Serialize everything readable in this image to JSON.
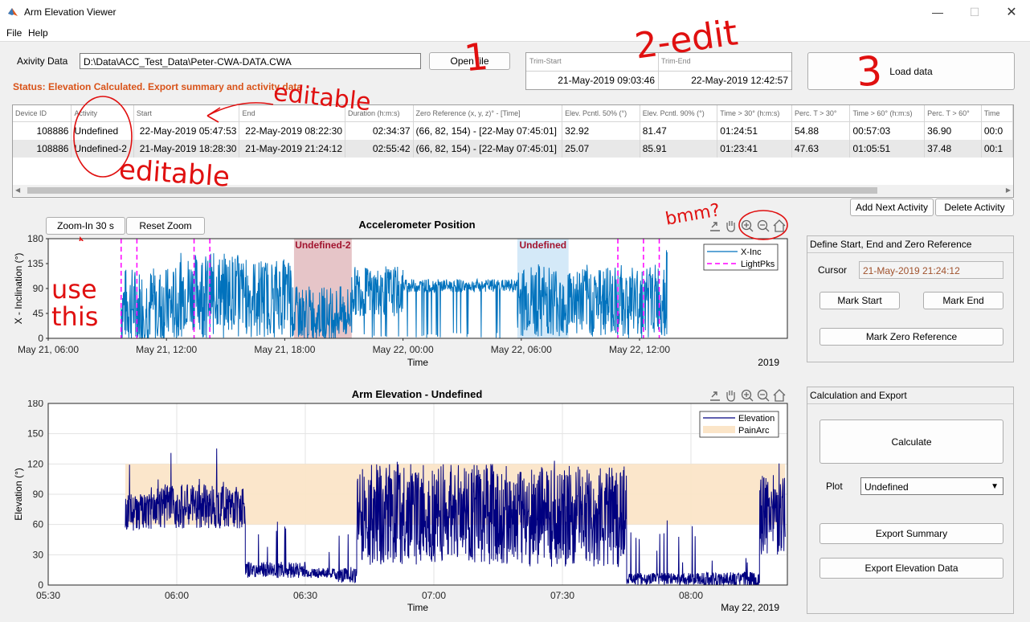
{
  "window": {
    "title": "Arm Elevation Viewer"
  },
  "menu": [
    "File",
    "Help"
  ],
  "data_row": {
    "label": "Axivity Data",
    "path": "D:\\Data\\ACC_Test_Data\\Peter-CWA-DATA.CWA",
    "open_button": "Open file"
  },
  "trim": {
    "start_label": "Trim-Start",
    "start_value": "21-May-2019 09:03:46",
    "end_label": "Trim-End",
    "end_value": "22-May-2019 12:42:57"
  },
  "load_button": "Load data",
  "status": "Status: Elevation Calculated. Export summary and activity data",
  "table": {
    "columns": [
      "Device ID",
      "Activity",
      "Start",
      "End",
      "Duration (h:m:s)",
      "Zero Reference (x, y, z)° - [Time]",
      "Elev. Pcntl. 50% (°)",
      "Elev. Pcntl. 90% (°)",
      "Time > 30° (h:m:s)",
      "Perc. T > 30°",
      "Time > 60° (h:m:s)",
      "Perc. T > 60°",
      "Time"
    ],
    "rows": [
      [
        "108886",
        "Undefined",
        "22-May-2019 05:47:53",
        "22-May-2019 08:22:30",
        "02:34:37",
        "(66, 82, 154) - [22-May 07:45:01]",
        "32.92",
        "81.47",
        "01:24:51",
        "54.88",
        "00:57:03",
        "36.90",
        "00:0"
      ],
      [
        "108886",
        "Undefined-2",
        "21-May-2019 18:28:30",
        "21-May-2019 21:24:12",
        "02:55:42",
        "(66, 82, 154) - [22-May 07:45:01]",
        "25.07",
        "85.91",
        "01:23:41",
        "47.63",
        "01:05:51",
        "37.48",
        "00:1"
      ]
    ]
  },
  "add_activity_button": "Add Next Activity",
  "delete_activity_button": "Delete Activity",
  "zoom_in_button": "Zoom-In 30 s",
  "reset_zoom_button": "Reset Zoom",
  "toolbar_icons": [
    "export-icon",
    "pan-hand-icon",
    "zoom-in-icon",
    "zoom-out-icon",
    "home-icon"
  ],
  "define_panel": {
    "title": "Define Start, End and Zero Reference",
    "cursor_label": "Cursor",
    "cursor_value": "21-May-2019 21:24:12",
    "mark_start": "Mark Start",
    "mark_end": "Mark End",
    "mark_zero": "Mark Zero Reference"
  },
  "calc_panel": {
    "title": "Calculation and Export",
    "calculate": "Calculate",
    "plot_label": "Plot",
    "plot_value": "Undefined",
    "export_summary": "Export Summary",
    "export_elevation": "Export Elevation Data"
  },
  "annotations": [
    "1",
    "2-edit",
    "3",
    "editable",
    "editable",
    "bmm?",
    "use this"
  ],
  "colors": {
    "status": "#d95319",
    "xinc": "#0072bd",
    "lightpks": "#ff00ff",
    "elevation": "#000080",
    "painarc": "#fbe5c8",
    "undef2_region": "#e6c5c8",
    "undef_region": "#d4e9f8",
    "region_label": "#a2142f",
    "annotation": "#e01010"
  },
  "chart_data": [
    {
      "type": "line",
      "title": "Accelerometer Position",
      "xlabel": "Time",
      "ylabel": "X - Inclination (°)",
      "ylim": [
        0,
        180
      ],
      "yticks": [
        0,
        45,
        90,
        135,
        180
      ],
      "xticks": [
        "May 21, 06:00",
        "May 21, 12:00",
        "May 21, 18:00",
        "May 22, 00:00",
        "May 22, 06:00",
        "May 22, 12:00"
      ],
      "x_year_label": "2019",
      "xlim_hours": [
        0,
        37.5
      ],
      "legend": {
        "placement": "top-right",
        "entries": [
          "X-Inc",
          "LightPks"
        ]
      },
      "regions": [
        {
          "label": "Undefined-2",
          "start_h": 12.47,
          "end_h": 15.4
        },
        {
          "label": "Undefined",
          "start_h": 23.8,
          "end_h": 26.4
        }
      ],
      "lightpks_h": [
        3.7,
        4.5,
        7.4,
        8.2,
        28.9,
        30.2,
        31.0
      ],
      "series": [
        {
          "name": "X-Inc",
          "segments": [
            {
              "start_h": 3.7,
              "end_h": 6.6,
              "base": 60,
              "amp": 70
            },
            {
              "start_h": 6.6,
              "end_h": 9.8,
              "base": 85,
              "amp": 70
            },
            {
              "start_h": 9.8,
              "end_h": 12.4,
              "base": 80,
              "amp": 65
            },
            {
              "start_h": 12.4,
              "end_h": 15.4,
              "base": 45,
              "amp": 50
            },
            {
              "start_h": 15.4,
              "end_h": 18.0,
              "base": 85,
              "amp": 45
            },
            {
              "start_h": 18.0,
              "end_h": 23.8,
              "base": 95,
              "amp": 12
            },
            {
              "start_h": 23.8,
              "end_h": 31.0,
              "base": 70,
              "amp": 65
            },
            {
              "start_h": 31.0,
              "end_h": 31.4,
              "base": 80,
              "amp": 80
            }
          ]
        }
      ]
    },
    {
      "type": "line",
      "title": "Arm Elevation - Undefined",
      "xlabel": "Time",
      "ylabel": "Elevation (°)",
      "ylim": [
        0,
        180
      ],
      "yticks": [
        0,
        30,
        60,
        90,
        120,
        150,
        180
      ],
      "xticks": [
        "05:30",
        "06:00",
        "06:30",
        "07:00",
        "07:30",
        "08:00"
      ],
      "x_date_label": "May 22, 2019",
      "xlim": [
        "05:30",
        "08:22:30"
      ],
      "legend": {
        "placement": "top-right",
        "entries": [
          "Elevation",
          "PainArc"
        ]
      },
      "painarc": [
        60,
        120
      ],
      "series": [
        {
          "name": "Elevation",
          "segments": [
            {
              "start": "05:48",
              "end": "05:54",
              "base": 72,
              "amp": 18
            },
            {
              "start": "05:54",
              "end": "06:16",
              "base": 78,
              "amp": 22
            },
            {
              "start": "06:16",
              "end": "06:30",
              "base": 15,
              "amp": 8
            },
            {
              "start": "06:30",
              "end": "06:37",
              "base": 12,
              "amp": 5
            },
            {
              "start": "06:37",
              "end": "06:42",
              "base": 10,
              "amp": 8
            },
            {
              "start": "06:42",
              "end": "07:19",
              "base": 70,
              "amp": 50
            },
            {
              "start": "07:19",
              "end": "07:45",
              "base": 68,
              "amp": 50
            },
            {
              "start": "07:45",
              "end": "08:03",
              "base": 6,
              "amp": 6
            },
            {
              "start": "08:03",
              "end": "08:16",
              "base": 5,
              "amp": 8
            },
            {
              "start": "08:16",
              "end": "08:22",
              "base": 70,
              "amp": 40
            }
          ]
        }
      ]
    }
  ]
}
